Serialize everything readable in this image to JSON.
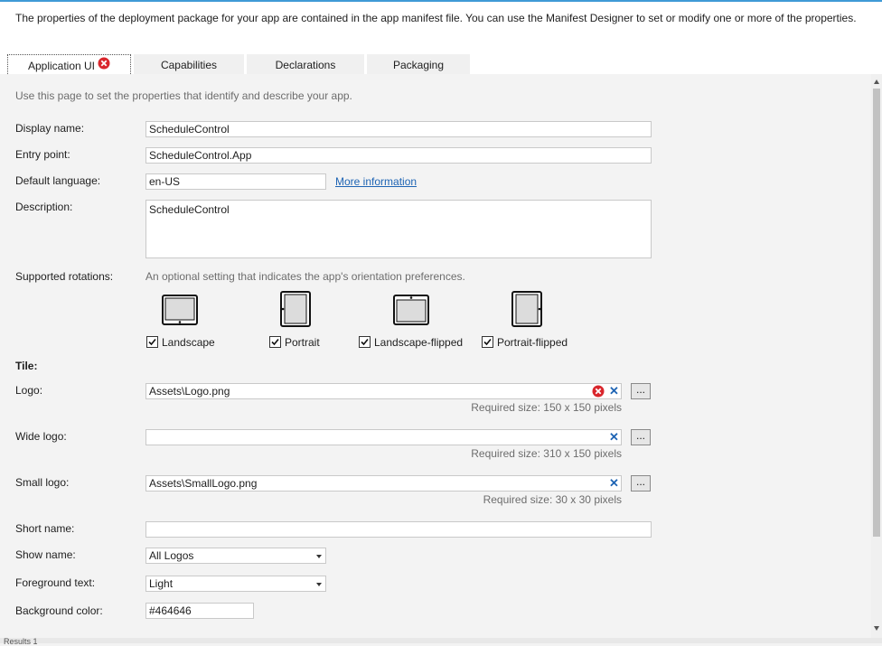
{
  "intro": "The properties of the deployment package for your app are contained in the app manifest file. You can use the Manifest Designer to set or modify one or more of the properties.",
  "tabs": [
    {
      "label": "Application UI"
    },
    {
      "label": "Capabilities"
    },
    {
      "label": "Declarations"
    },
    {
      "label": "Packaging"
    }
  ],
  "hint": "Use this page to set the properties that identify and describe your app.",
  "fields": {
    "display_name": {
      "label": "Display name:",
      "value": "ScheduleControl"
    },
    "entry_point": {
      "label": "Entry point:",
      "value": "ScheduleControl.App"
    },
    "default_language": {
      "label": "Default language:",
      "value": "en-US",
      "link": "More information"
    },
    "description": {
      "label": "Description:",
      "value": "ScheduleControl"
    }
  },
  "rotations": {
    "label": "Supported rotations:",
    "hint": "An optional setting that indicates the app's orientation preferences.",
    "options": [
      {
        "label": "Landscape",
        "checked": true,
        "icon": "landscape-icon"
      },
      {
        "label": "Portrait",
        "checked": true,
        "icon": "portrait-icon"
      },
      {
        "label": "Landscape-flipped",
        "checked": true,
        "icon": "landscape-flipped-icon"
      },
      {
        "label": "Portrait-flipped",
        "checked": true,
        "icon": "portrait-flipped-icon"
      }
    ]
  },
  "tile": {
    "heading": "Tile:",
    "logo": {
      "label": "Logo:",
      "value": "Assets\\Logo.png",
      "required": "Required size: 150 x 150 pixels"
    },
    "wide_logo": {
      "label": "Wide logo:",
      "value": "",
      "required": "Required size: 310 x 150 pixels"
    },
    "small_logo": {
      "label": "Small logo:",
      "value": "Assets\\SmallLogo.png",
      "required": "Required size: 30 x 30 pixels"
    },
    "browse_label": "...",
    "short_name": {
      "label": "Short name:",
      "value": ""
    },
    "show_name": {
      "label": "Show name:",
      "value": "All Logos"
    },
    "foreground_text": {
      "label": "Foreground text:",
      "value": "Light"
    },
    "background_color": {
      "label": "Background color:",
      "value": "#464646"
    }
  },
  "bottom_text": "Results 1",
  "colors": {
    "accent": "#3f9ad6",
    "link": "#1e64b4",
    "error": "#d9262c"
  }
}
